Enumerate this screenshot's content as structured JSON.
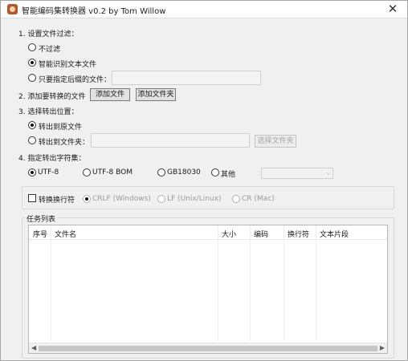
{
  "window": {
    "title": "智能编码集转换器 v0.2 by Tom Willow",
    "close_glyph": "✕"
  },
  "filter": {
    "heading": "1. 设置文件过滤：",
    "options": [
      "不过滤",
      "智能识别文本文件",
      "只要指定后缀的文件："
    ],
    "selected": 1
  },
  "add": {
    "heading": "2. 添加要转换的文件",
    "add_file": "添加文件",
    "add_folder": "添加文件夹"
  },
  "output": {
    "heading": "3. 选择转出位置：",
    "options": [
      "转出到原文件",
      "转出到文件夹："
    ],
    "selected": 0,
    "choose_folder": "选择文件夹"
  },
  "charset": {
    "heading": "4. 指定转出字符集：",
    "options": [
      "UTF-8",
      "UTF-8 BOM",
      "GB18030",
      "其他"
    ],
    "selected": 0
  },
  "newline": {
    "checkbox_label": "转换换行符",
    "checked": false,
    "options": [
      "CRLF (Windows)",
      "LF (Unix/Linux)",
      "CR (Mac)"
    ],
    "selected": 0
  },
  "tasks": {
    "heading": "任务列表",
    "columns": [
      "序号",
      "文件名",
      "大小",
      "编码",
      "换行符",
      "文本片段"
    ],
    "rows": []
  },
  "icons": {
    "app": "app-logo-icon",
    "scroll_left": "◀",
    "scroll_right": "▶",
    "dropdown": "⌵"
  }
}
